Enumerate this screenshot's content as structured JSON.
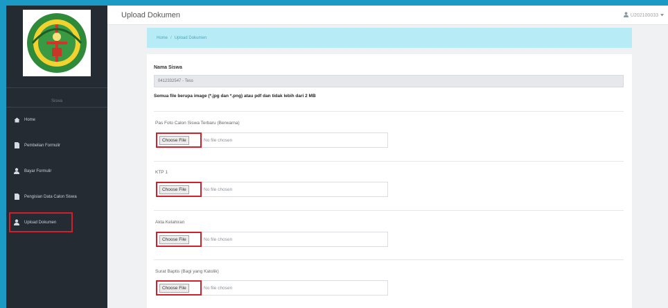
{
  "app": {
    "title": "Upload Dokumen",
    "user_label": "U202100033"
  },
  "sidebar": {
    "caption": "Siswa",
    "items": [
      {
        "label": "Home",
        "icon": "home-icon"
      },
      {
        "label": "Pembelian Formulir",
        "icon": "file-icon"
      },
      {
        "label": "Bayar Formulir",
        "icon": "user-icon"
      },
      {
        "label": "Pengisian Data Calon Siswa",
        "icon": "file-icon"
      },
      {
        "label": "Upload Dokumen",
        "icon": "user-icon"
      }
    ]
  },
  "breadcrumb": {
    "home": "Home",
    "current": "Upload Dokumen"
  },
  "form": {
    "name_label": "Nama Siswa",
    "name_value": "0412332547 - Tess",
    "note": "Semua file berupa image (*.jpg dan *.png) atau pdf dan tidak lebih dari 2 MB",
    "fields": [
      {
        "label": "Pas Foto Calon Siswa Terbaru (Berwarna)",
        "button": "Choose File",
        "status": "No file chosen"
      },
      {
        "label": "KTP 1",
        "button": "Choose File",
        "status": "No file chosen"
      },
      {
        "label": "Akta Kelahiran",
        "button": "Choose File",
        "status": "No file chosen"
      },
      {
        "label": "Surat Baptis (Bagi yang Katolik)",
        "button": "Choose File",
        "status": "No file chosen"
      }
    ]
  },
  "colors": {
    "frame": "#1a9ac4",
    "sidebar": "#242b33",
    "highlight": "#d21f2c",
    "breadcrumb_bg": "#b7ebf6"
  }
}
